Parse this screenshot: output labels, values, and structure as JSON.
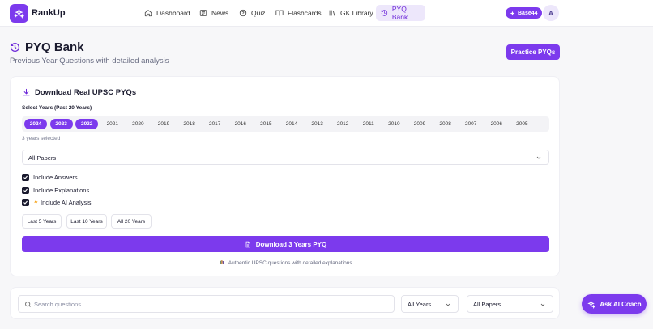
{
  "app": {
    "name": "RankUp"
  },
  "nav": {
    "items": [
      {
        "label": "Dashboard",
        "icon": "home-icon"
      },
      {
        "label": "News",
        "icon": "newspaper-icon"
      },
      {
        "label": "Quiz",
        "icon": "quiz-icon"
      },
      {
        "label": "Flashcards",
        "icon": "book-open-icon"
      },
      {
        "label": "GK Library",
        "icon": "library-icon"
      },
      {
        "label": "PYQ Bank",
        "icon": "history-icon",
        "active": true
      }
    ],
    "badge": "Base44",
    "avatar": "A"
  },
  "header": {
    "title": "PYQ Bank",
    "subtitle": "Previous Year Questions with detailed analysis",
    "practice_button": "Practice PYQs"
  },
  "download": {
    "title": "Download Real UPSC PYQs",
    "select_label": "Select Years (Past 20 Years)",
    "years": [
      "2024",
      "2023",
      "2022",
      "2021",
      "2020",
      "2019",
      "2018",
      "2017",
      "2016",
      "2015",
      "2014",
      "2013",
      "2012",
      "2011",
      "2010",
      "2009",
      "2008",
      "2007",
      "2006",
      "2005"
    ],
    "selected_years": [
      "2024",
      "2023",
      "2022"
    ],
    "selected_count_text": "3 years selected",
    "paper_select": "All Papers",
    "options": {
      "answers": "Include Answers",
      "explanations": "Include Explanations",
      "ai_analysis": "Include AI Analysis"
    },
    "ranges": [
      "Last 5 Years",
      "Last 10 Years",
      "All 20 Years"
    ],
    "download_button": "Download 3 Years PYQ",
    "footnote": "Authentic UPSC questions with detailed explanations"
  },
  "search": {
    "placeholder": "Search questions...",
    "year_filter": "All Years",
    "paper_filter": "All Papers"
  },
  "coach_button": "Ask AI Coach",
  "colors": {
    "accent": "#7c3aed",
    "accent_light": "#ede7fb"
  }
}
